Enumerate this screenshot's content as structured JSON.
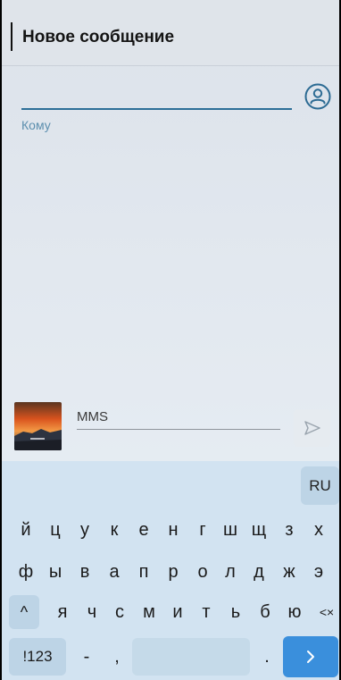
{
  "header": {
    "title": "Новое сообщение"
  },
  "recipient": {
    "label": "Кому"
  },
  "compose": {
    "placeholder": "MMS"
  },
  "keyboard": {
    "lang": "RU",
    "row1": [
      "й",
      "ц",
      "у",
      "к",
      "е",
      "н",
      "г",
      "ш",
      "щ",
      "з",
      "х"
    ],
    "row2": [
      "ф",
      "ы",
      "в",
      "а",
      "п",
      "р",
      "о",
      "л",
      "д",
      "ж",
      "э"
    ],
    "row3": [
      "я",
      "ч",
      "с",
      "м",
      "и",
      "т",
      "ь",
      "б",
      "ю"
    ],
    "shift": "^",
    "backspace": "<×",
    "symbols": "!123",
    "minus": "-",
    "comma": ",",
    "dot": ".",
    "enter": "›"
  },
  "icons": {
    "contact": "contact-picker-icon",
    "send": "send-icon",
    "attachment": "attachment-thumbnail"
  },
  "colors": {
    "accent": "#2d6f98",
    "label": "#5c8fae",
    "keyboard_bg": "#d2e3f1",
    "enter_key": "#3a8fdc"
  }
}
